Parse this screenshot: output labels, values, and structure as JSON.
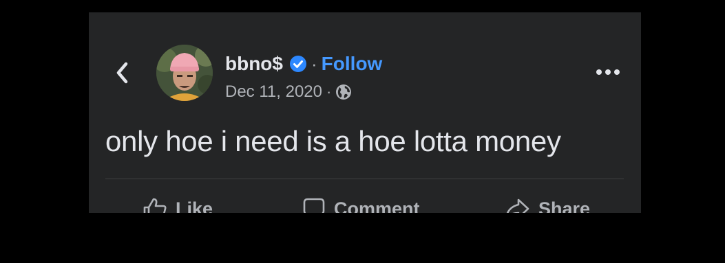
{
  "post": {
    "author": "bbno$",
    "separator": "·",
    "follow_label": "Follow",
    "date": "Dec 11, 2020",
    "meta_separator": "·",
    "text": "only hoe i need is a hoe lotta money"
  },
  "actions": {
    "like_label": "Like",
    "comment_label": "Comment",
    "share_label": "Share"
  },
  "icons": {
    "back": "chevron-left-icon",
    "verified": "verified-badge-icon",
    "privacy": "globe-icon",
    "more": "more-horizontal-icon",
    "like": "thumbs-up-icon",
    "comment": "comment-bubble-icon",
    "share": "share-arrow-icon"
  },
  "colors": {
    "card_background": "#242526",
    "primary_text": "#e4e6eb",
    "secondary_text": "#b0b3b8",
    "follow_link": "#4599ff",
    "verified_badge": "#2d88ff"
  }
}
